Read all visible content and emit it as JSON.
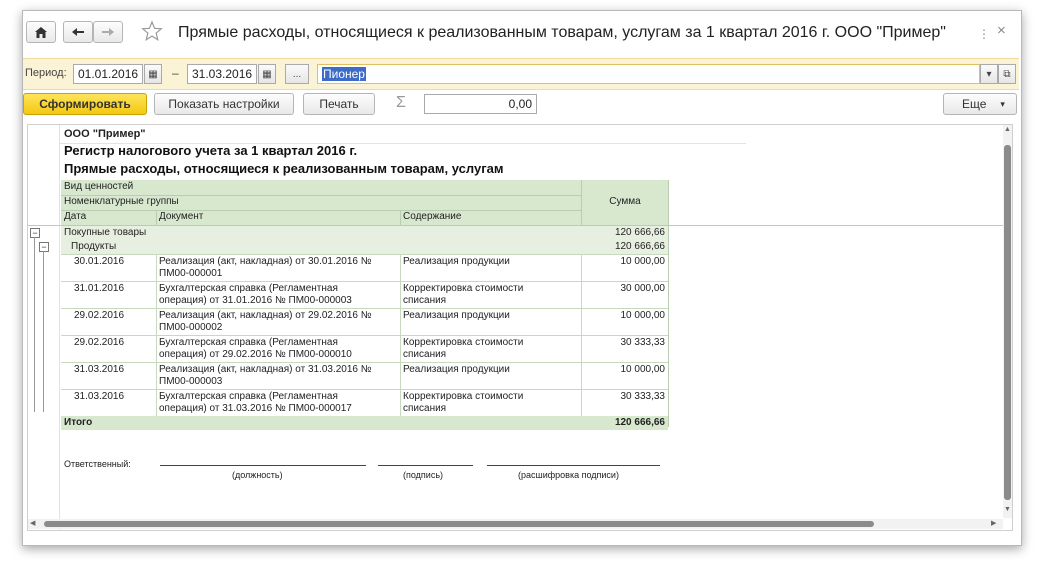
{
  "window": {
    "title": "Прямые расходы, относящиеся к реализованным товарам, услугам за 1 квартал 2016 г. ООО \"Пример\""
  },
  "filters": {
    "period_label": "Период:",
    "date_from": "01.01.2016",
    "dash": "–",
    "date_to": "31.03.2016",
    "choose_label": "...",
    "org_value": "Пионер"
  },
  "toolbar": {
    "generate": "Сформировать",
    "settings": "Показать настройки",
    "print": "Печать",
    "sum_symbol": "Σ",
    "sum_value": "0,00",
    "more": "Еще"
  },
  "report": {
    "org": "ООО \"Пример\"",
    "title1": "Регистр налогового учета за 1 квартал 2016 г.",
    "title2": "Прямые расходы, относящиеся к реализованным товарам, услугам",
    "headers": {
      "kind": "Вид ценностей",
      "group": "Номенклатурные группы",
      "date": "Дата",
      "doc": "Документ",
      "content": "Содержание",
      "sum": "Сумма"
    },
    "group1": {
      "label": "Покупные товары",
      "sum": "120 666,66"
    },
    "group2": {
      "label": "Продукты",
      "sum": "120 666,66"
    },
    "rows": [
      {
        "date": "30.01.2016",
        "doc1": "Реализация (акт, накладная) от 30.01.2016 №",
        "doc2": "ПМ00-000001",
        "c1": "Реализация продукции",
        "c2": "",
        "sum": "10 000,00"
      },
      {
        "date": "31.01.2016",
        "doc1": "Бухгалтерская справка (Регламентная",
        "doc2": "операция) от 31.01.2016 № ПМ00-000003",
        "c1": "Корректировка стоимости",
        "c2": "списания",
        "sum": "30 000,00"
      },
      {
        "date": "29.02.2016",
        "doc1": "Реализация (акт, накладная) от 29.02.2016 №",
        "doc2": "ПМ00-000002",
        "c1": "Реализация продукции",
        "c2": "",
        "sum": "10 000,00"
      },
      {
        "date": "29.02.2016",
        "doc1": "Бухгалтерская справка (Регламентная",
        "doc2": "операция) от 29.02.2016 № ПМ00-000010",
        "c1": "Корректировка стоимости",
        "c2": "списания",
        "sum": "30 333,33"
      },
      {
        "date": "31.03.2016",
        "doc1": "Реализация (акт, накладная) от 31.03.2016 №",
        "doc2": "ПМ00-000003",
        "c1": "Реализация продукции",
        "c2": "",
        "sum": "10 000,00"
      },
      {
        "date": "31.03.2016",
        "doc1": "Бухгалтерская справка (Регламентная",
        "doc2": "операция) от 31.03.2016 № ПМ00-000017",
        "c1": "Корректировка стоимости",
        "c2": "списания",
        "sum": "30 333,33"
      }
    ],
    "total": {
      "label": "Итого",
      "sum": "120 666,66"
    },
    "signature": {
      "responsible": "Ответственный:",
      "position": "(должность)",
      "sign": "(подпись)",
      "decode": "(расшифровка подписи)"
    }
  }
}
